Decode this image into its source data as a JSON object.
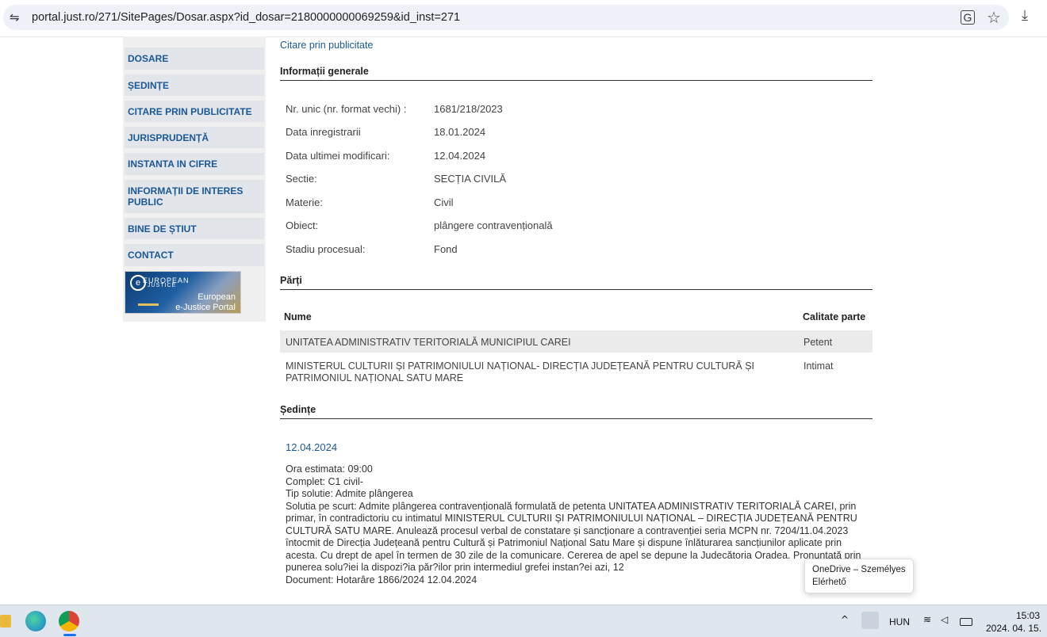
{
  "browser": {
    "url": "portal.just.ro/271/SitePages/Dosar.aspx?id_dosar=2180000000069259&id_inst=271"
  },
  "sidebar": {
    "items": [
      "DOSARE",
      "ȘEDINȚE",
      "CITARE PRIN PUBLICITATE",
      "JURISPRUDENȚĂ",
      "INSTANTA IN CIFRE",
      "INFORMAȚII DE INTERES PUBLIC",
      "BINE DE ȘTIUT",
      "CONTACT"
    ],
    "banner": {
      "line1": "EUROPEAN",
      "line2": "JUSTICE",
      "line3": "European",
      "line4": "e-Justice Portal"
    }
  },
  "main": {
    "top_link": "Citare prin publicitate",
    "general": {
      "title": "Informații generale",
      "fields": [
        {
          "label": "Nr. unic (nr. format vechi) :",
          "value": "1681/218/2023"
        },
        {
          "label": "Data inregistrarii",
          "value": "18.01.2024"
        },
        {
          "label": "Data ultimei modificari:",
          "value": "12.04.2024"
        },
        {
          "label": "Sectie:",
          "value": "SECȚIA CIVILĂ"
        },
        {
          "label": "Materie:",
          "value": "Civil"
        },
        {
          "label": "Obiect:",
          "value": "plângere contravențională"
        },
        {
          "label": "Stadiu procesual:",
          "value": "Fond"
        }
      ]
    },
    "parti": {
      "title": "Părți",
      "col_name": "Nume",
      "col_role": "Calitate parte",
      "rows": [
        {
          "name": "UNITATEA ADMINISTRATIV TERITORIALĂ MUNICIPIUL CAREI",
          "role": "Petent"
        },
        {
          "name": "MINISTERUL CULTURII ȘI PATRIMONIULUI NAȚIONAL- DIRECȚIA JUDEȚEANĂ PENTRU CULTURĂ ȘI PATRIMONIUL NAȚIONAL SATU MARE",
          "role": "Intimat"
        }
      ]
    },
    "sedinte": {
      "title": "Ședințe",
      "date": "12.04.2024",
      "lines": [
        "Ora estimata: 09:00",
        "Complet: C1 civil-",
        "Tip solutie: Admite plângerea",
        "Solutia pe scurt: Admite plângerea contravențională formulată de petenta UNITATEA ADMINISTRATIV TERITORIALĂ CAREI, prin primar, în contradictoriu cu intimatul MINISTERUL CULTURII ȘI PATRIMONIULUI NAȚIONAL – DIRECȚIA JUDEȚEANĂ PENTRU CULTURĂ SATU MARE. Anulează procesul verbal de constatare și sancționare a contravenției seria MCPN nr. 7204/11.04.2023 întocmit de Direcția Județeană pentru Cultură și Patrimoniul Național Satu Mare și dispune înlăturarea sancțiunilor aplicate prin acesta. Cu drept de apel în termen de 30 zile de la comunicare. Cererea de apel se depune la Judecătoria Oradea. Pronunțată prin punerea solu?iei la dispozi?ia păr?ilor prin intermediul grefei instan?ei azi, 12",
        "Document: Hotarâre  1866/2024  12.04.2024"
      ]
    }
  },
  "tooltip": {
    "line1": "OneDrive – Személyes",
    "line2": "Elérhető"
  },
  "taskbar": {
    "lang": "HUN",
    "time": "15:03",
    "date": "2024. 04. 15."
  }
}
